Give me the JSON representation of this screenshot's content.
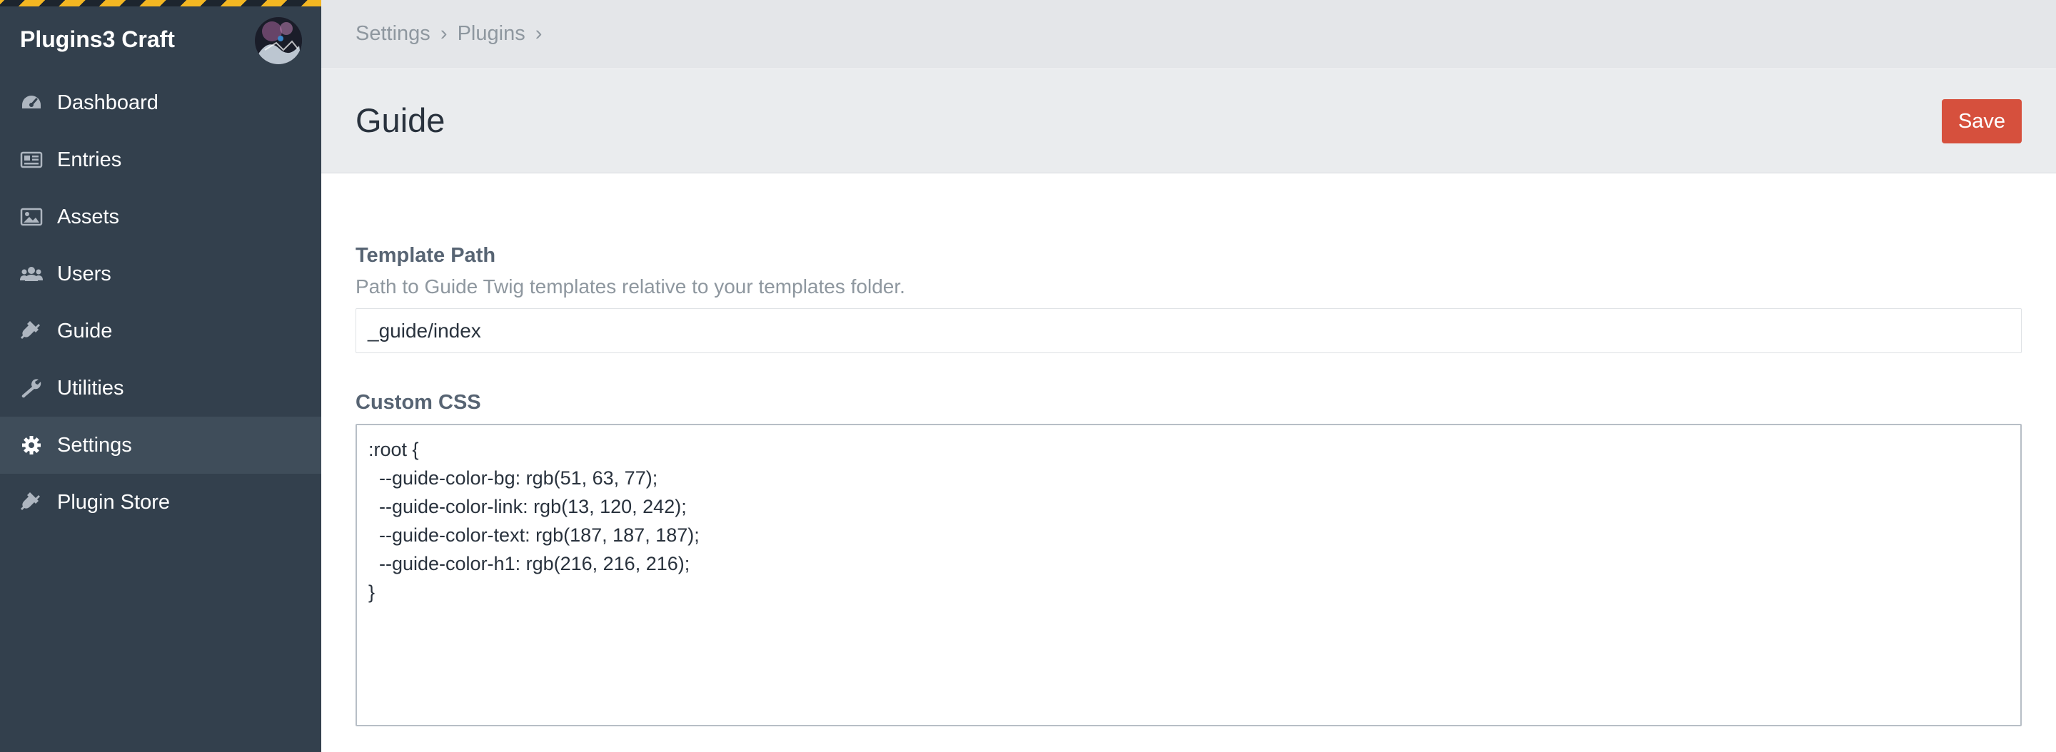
{
  "sidebar": {
    "site_name": "Plugins3 Craft",
    "env_stripe_colors": [
      "#f4b722",
      "#1d252e"
    ],
    "avatar_icon": "user-avatar-photo",
    "items": [
      {
        "label": "Dashboard",
        "icon": "gauge-icon",
        "active": false
      },
      {
        "label": "Entries",
        "icon": "newspaper-icon",
        "active": false
      },
      {
        "label": "Assets",
        "icon": "image-icon",
        "active": false
      },
      {
        "label": "Users",
        "icon": "users-icon",
        "active": false
      },
      {
        "label": "Guide",
        "icon": "plug-icon",
        "active": false
      },
      {
        "label": "Utilities",
        "icon": "wrench-icon",
        "active": false
      },
      {
        "label": "Settings",
        "icon": "gear-icon",
        "active": true
      },
      {
        "label": "Plugin Store",
        "icon": "plug-icon",
        "active": false
      }
    ]
  },
  "breadcrumb": {
    "items": [
      "Settings",
      "Plugins"
    ],
    "separator": "›"
  },
  "page": {
    "title": "Guide",
    "save_label": "Save",
    "save_color": "#d6503d"
  },
  "fields": {
    "template_path": {
      "label": "Template Path",
      "instructions": "Path to Guide Twig templates relative to your templates folder.",
      "value": "_guide/index"
    },
    "custom_css": {
      "label": "Custom CSS",
      "value": ":root {\n  --guide-color-bg: rgb(51, 63, 77);\n  --guide-color-link: rgb(13, 120, 242);\n  --guide-color-text: rgb(187, 187, 187);\n  --guide-color-h1: rgb(216, 216, 216);\n}"
    }
  }
}
